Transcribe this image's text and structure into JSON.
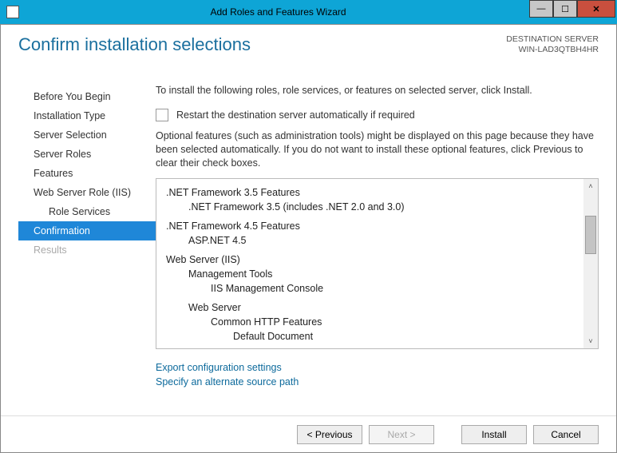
{
  "window": {
    "title": "Add Roles and Features Wizard"
  },
  "destination": {
    "label": "DESTINATION SERVER",
    "server": "WIN-LAD3QTBH4HR"
  },
  "page_title": "Confirm installation selections",
  "nav": {
    "items": [
      {
        "label": "Before You Begin"
      },
      {
        "label": "Installation Type"
      },
      {
        "label": "Server Selection"
      },
      {
        "label": "Server Roles"
      },
      {
        "label": "Features"
      },
      {
        "label": "Web Server Role (IIS)"
      },
      {
        "label": "Role Services"
      },
      {
        "label": "Confirmation"
      },
      {
        "label": "Results"
      }
    ]
  },
  "main": {
    "intro": "To install the following roles, role services, or features on selected server, click Install.",
    "restart_label": "Restart the destination server automatically if required",
    "optional_text": "Optional features (such as administration tools) might be displayed on this page because they have been selected automatically. If you do not want to install these optional features, click Previous to clear their check boxes.",
    "tree": {
      "a0": ".NET Framework 3.5 Features",
      "a1": ".NET Framework 3.5 (includes .NET 2.0 and 3.0)",
      "b0": ".NET Framework 4.5 Features",
      "b1": "ASP.NET 4.5",
      "c0": "Web Server (IIS)",
      "c1": "Management Tools",
      "c2": "IIS Management Console",
      "c3": "Web Server",
      "c4": "Common HTTP Features",
      "c5": "Default Document"
    },
    "export_link": "Export configuration settings",
    "alt_path_link": "Specify an alternate source path"
  },
  "footer": {
    "previous": "< Previous",
    "next": "Next >",
    "install": "Install",
    "cancel": "Cancel"
  }
}
